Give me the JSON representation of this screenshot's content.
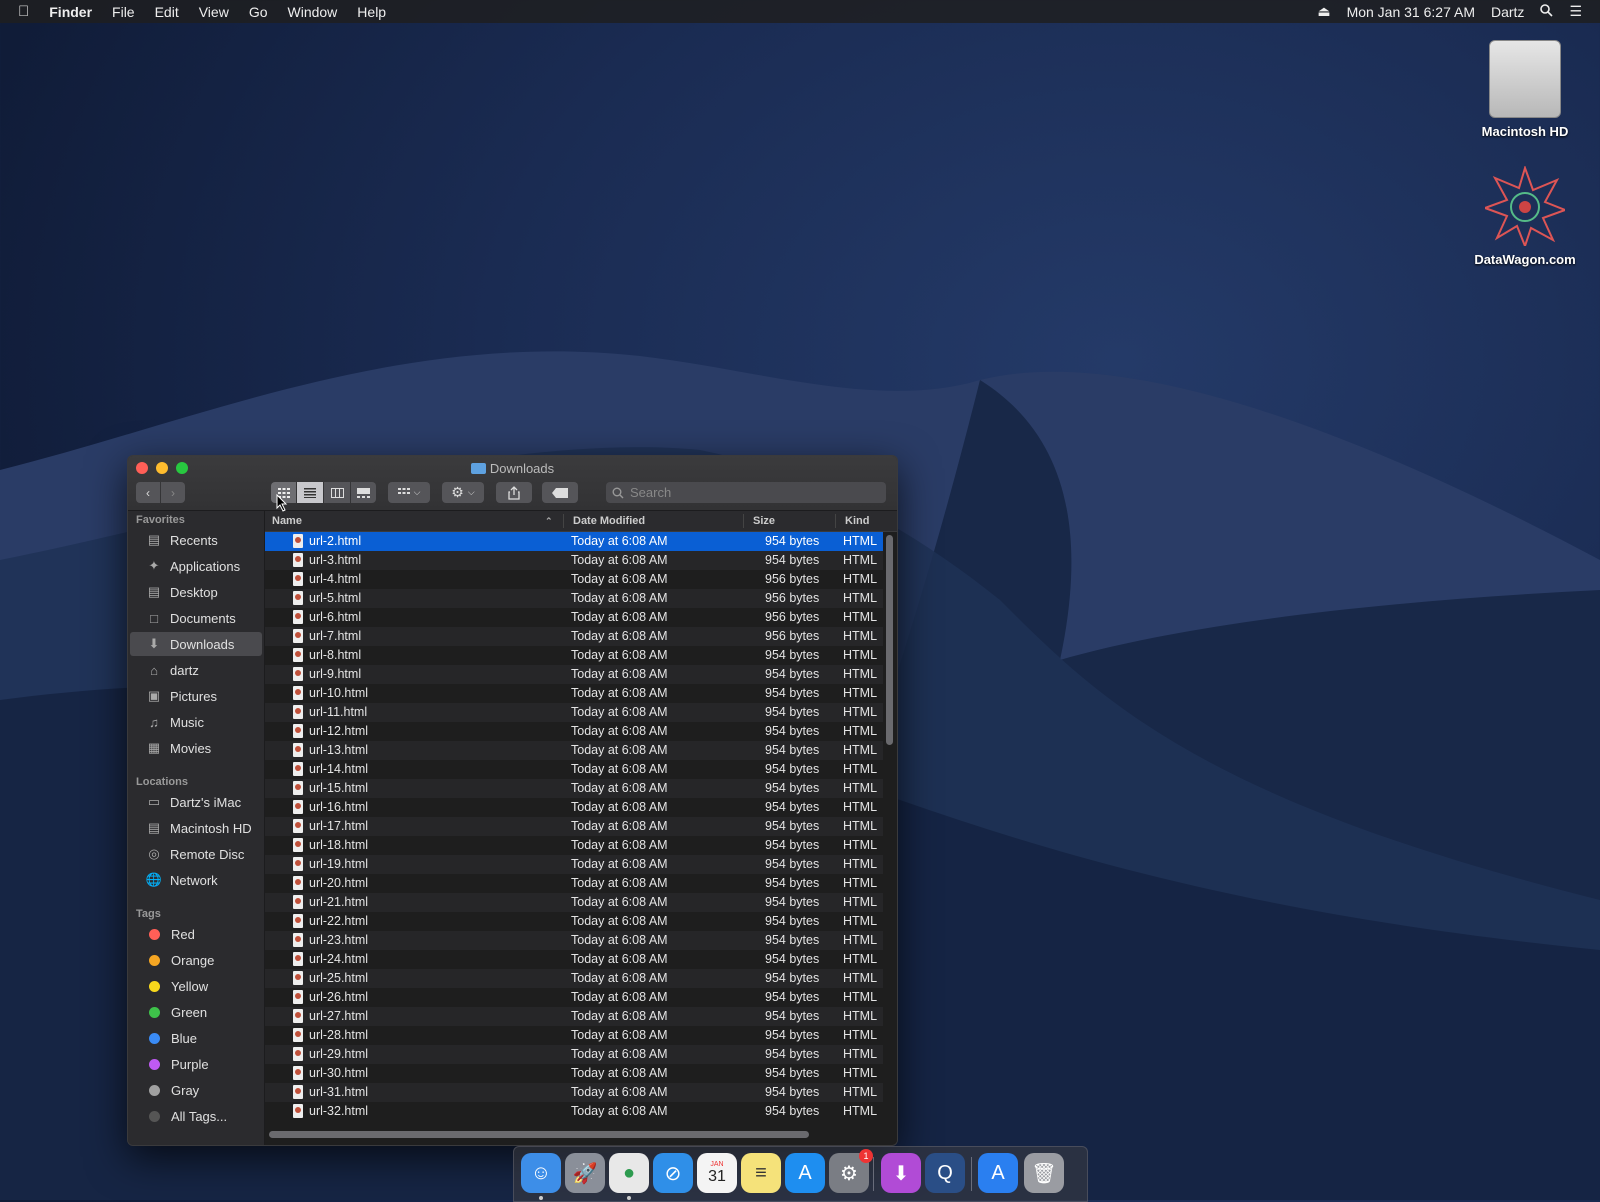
{
  "menubar": {
    "apple": "",
    "app": "Finder",
    "items": [
      "File",
      "Edit",
      "View",
      "Go",
      "Window",
      "Help"
    ],
    "clock": "Mon Jan 31  6:27 AM",
    "user": "Dartz"
  },
  "desktop": {
    "icons": [
      {
        "label": "Macintosh HD",
        "icon": "hard-drive-icon"
      },
      {
        "label": "DataWagon.com",
        "icon": "datawagon-icon"
      }
    ]
  },
  "window": {
    "title": "Downloads",
    "search_placeholder": "Search",
    "sidebar": {
      "favorites_heading": "Favorites",
      "favorites": [
        "Recents",
        "Applications",
        "Desktop",
        "Documents",
        "Downloads",
        "dartz",
        "Pictures",
        "Music",
        "Movies"
      ],
      "locations_heading": "Locations",
      "locations": [
        "Dartz's iMac",
        "Macintosh HD",
        "Remote Disc",
        "Network"
      ],
      "tags_heading": "Tags",
      "tags": [
        {
          "label": "Red",
          "color": "#ff5f57"
        },
        {
          "label": "Orange",
          "color": "#f5a623"
        },
        {
          "label": "Yellow",
          "color": "#f8d81c"
        },
        {
          "label": "Green",
          "color": "#3ec24a"
        },
        {
          "label": "Blue",
          "color": "#3a8bf5"
        },
        {
          "label": "Purple",
          "color": "#bf5af2"
        },
        {
          "label": "Gray",
          "color": "#a0a0a0"
        },
        {
          "label": "All Tags...",
          "color": "#555555"
        }
      ]
    },
    "columns": {
      "name": "Name",
      "date": "Date Modified",
      "size": "Size",
      "kind": "Kind"
    },
    "files": [
      {
        "name": "url-2.html",
        "date": "Today at 6:08 AM",
        "size": "954 bytes",
        "kind": "HTML"
      },
      {
        "name": "url-3.html",
        "date": "Today at 6:08 AM",
        "size": "954 bytes",
        "kind": "HTML"
      },
      {
        "name": "url-4.html",
        "date": "Today at 6:08 AM",
        "size": "956 bytes",
        "kind": "HTML"
      },
      {
        "name": "url-5.html",
        "date": "Today at 6:08 AM",
        "size": "956 bytes",
        "kind": "HTML"
      },
      {
        "name": "url-6.html",
        "date": "Today at 6:08 AM",
        "size": "956 bytes",
        "kind": "HTML"
      },
      {
        "name": "url-7.html",
        "date": "Today at 6:08 AM",
        "size": "956 bytes",
        "kind": "HTML"
      },
      {
        "name": "url-8.html",
        "date": "Today at 6:08 AM",
        "size": "954 bytes",
        "kind": "HTML"
      },
      {
        "name": "url-9.html",
        "date": "Today at 6:08 AM",
        "size": "954 bytes",
        "kind": "HTML"
      },
      {
        "name": "url-10.html",
        "date": "Today at 6:08 AM",
        "size": "954 bytes",
        "kind": "HTML"
      },
      {
        "name": "url-11.html",
        "date": "Today at 6:08 AM",
        "size": "954 bytes",
        "kind": "HTML"
      },
      {
        "name": "url-12.html",
        "date": "Today at 6:08 AM",
        "size": "954 bytes",
        "kind": "HTML"
      },
      {
        "name": "url-13.html",
        "date": "Today at 6:08 AM",
        "size": "954 bytes",
        "kind": "HTML"
      },
      {
        "name": "url-14.html",
        "date": "Today at 6:08 AM",
        "size": "954 bytes",
        "kind": "HTML"
      },
      {
        "name": "url-15.html",
        "date": "Today at 6:08 AM",
        "size": "954 bytes",
        "kind": "HTML"
      },
      {
        "name": "url-16.html",
        "date": "Today at 6:08 AM",
        "size": "954 bytes",
        "kind": "HTML"
      },
      {
        "name": "url-17.html",
        "date": "Today at 6:08 AM",
        "size": "954 bytes",
        "kind": "HTML"
      },
      {
        "name": "url-18.html",
        "date": "Today at 6:08 AM",
        "size": "954 bytes",
        "kind": "HTML"
      },
      {
        "name": "url-19.html",
        "date": "Today at 6:08 AM",
        "size": "954 bytes",
        "kind": "HTML"
      },
      {
        "name": "url-20.html",
        "date": "Today at 6:08 AM",
        "size": "954 bytes",
        "kind": "HTML"
      },
      {
        "name": "url-21.html",
        "date": "Today at 6:08 AM",
        "size": "954 bytes",
        "kind": "HTML"
      },
      {
        "name": "url-22.html",
        "date": "Today at 6:08 AM",
        "size": "954 bytes",
        "kind": "HTML"
      },
      {
        "name": "url-23.html",
        "date": "Today at 6:08 AM",
        "size": "954 bytes",
        "kind": "HTML"
      },
      {
        "name": "url-24.html",
        "date": "Today at 6:08 AM",
        "size": "954 bytes",
        "kind": "HTML"
      },
      {
        "name": "url-25.html",
        "date": "Today at 6:08 AM",
        "size": "954 bytes",
        "kind": "HTML"
      },
      {
        "name": "url-26.html",
        "date": "Today at 6:08 AM",
        "size": "954 bytes",
        "kind": "HTML"
      },
      {
        "name": "url-27.html",
        "date": "Today at 6:08 AM",
        "size": "954 bytes",
        "kind": "HTML"
      },
      {
        "name": "url-28.html",
        "date": "Today at 6:08 AM",
        "size": "954 bytes",
        "kind": "HTML"
      },
      {
        "name": "url-29.html",
        "date": "Today at 6:08 AM",
        "size": "954 bytes",
        "kind": "HTML"
      },
      {
        "name": "url-30.html",
        "date": "Today at 6:08 AM",
        "size": "954 bytes",
        "kind": "HTML"
      },
      {
        "name": "url-31.html",
        "date": "Today at 6:08 AM",
        "size": "954 bytes",
        "kind": "HTML"
      },
      {
        "name": "url-32.html",
        "date": "Today at 6:08 AM",
        "size": "954 bytes",
        "kind": "HTML"
      }
    ],
    "selected_index": 0
  },
  "dock": {
    "apps": [
      {
        "icon": "finder-icon",
        "color": "#3d8ee8",
        "running": true
      },
      {
        "icon": "launchpad-icon",
        "color": "#8a8f99",
        "running": false
      },
      {
        "icon": "chrome-icon",
        "color": "#e8e8e8",
        "running": true
      },
      {
        "icon": "safari-icon",
        "color": "#2f8fe8",
        "running": false
      },
      {
        "icon": "calendar-icon",
        "color": "#f4f4f4",
        "running": false
      },
      {
        "icon": "notes-icon",
        "color": "#f5e27a",
        "running": false
      },
      {
        "icon": "app-store-icon",
        "color": "#1e8ef0",
        "running": false
      },
      {
        "icon": "system-preferences-icon",
        "color": "#7a7d84",
        "running": false
      },
      {
        "icon": "installer-icon",
        "color": "#b14bd6",
        "running": false
      },
      {
        "icon": "quicktime-icon",
        "color": "#2a4e86",
        "running": false
      },
      {
        "icon": "app-store-folder-icon",
        "color": "#2a7ff0",
        "running": false
      },
      {
        "icon": "trash-icon",
        "color": "#9a9ca2",
        "running": false
      }
    ],
    "calendar_day": "31",
    "calendar_month": "JAN",
    "notification_badge": "1"
  }
}
